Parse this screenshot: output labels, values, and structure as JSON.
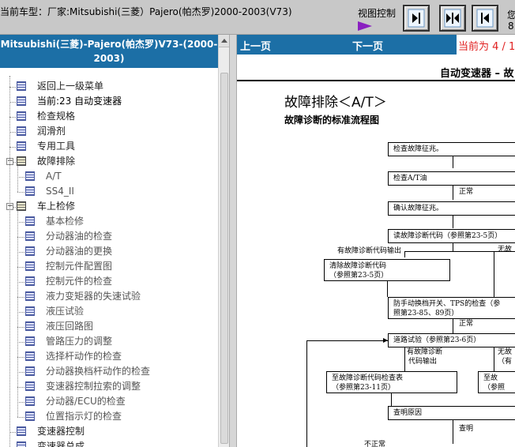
{
  "topbar": {
    "car_model": "当前车型：厂家:Mitsubishi(三菱）Pajero(帕杰罗)2000-2003(V73)",
    "view_control_label": "视图控制",
    "cut_char_1": "您",
    "cut_char_2": "8"
  },
  "left_panel": {
    "title": "Mitsubishi(三菱)-Pajero(帕杰罗)V73-(2000-2003)",
    "tree": [
      {
        "label": "返回上一级菜单",
        "level": 1,
        "type": "page"
      },
      {
        "label": "当前:23 自动变速器",
        "level": 1,
        "type": "page",
        "current": true
      },
      {
        "label": "检查规格",
        "level": 1,
        "type": "page"
      },
      {
        "label": "润滑剂",
        "level": 1,
        "type": "page"
      },
      {
        "label": "专用工具",
        "level": 1,
        "type": "page"
      },
      {
        "label": "故障排除",
        "level": 1,
        "type": "folder",
        "expanded": true
      },
      {
        "label": "A/T",
        "level": 2,
        "type": "page"
      },
      {
        "label": "SS4_II",
        "level": 2,
        "type": "page"
      },
      {
        "label": "车上检修",
        "level": 1,
        "type": "folder",
        "expanded": true
      },
      {
        "label": "基本检修",
        "level": 2,
        "type": "page"
      },
      {
        "label": "分动器油的检查",
        "level": 2,
        "type": "page"
      },
      {
        "label": "分动器油的更换",
        "level": 2,
        "type": "page"
      },
      {
        "label": "控制元件配置图",
        "level": 2,
        "type": "page"
      },
      {
        "label": "控制元件的检查",
        "level": 2,
        "type": "page"
      },
      {
        "label": "液力变矩器的失速试验",
        "level": 2,
        "type": "page"
      },
      {
        "label": "液压试验",
        "level": 2,
        "type": "page"
      },
      {
        "label": "液压回路图",
        "level": 2,
        "type": "page"
      },
      {
        "label": "管路压力的调整",
        "level": 2,
        "type": "page"
      },
      {
        "label": "选择杆动作的检查",
        "level": 2,
        "type": "page"
      },
      {
        "label": "分动器换档杆动作的检查",
        "level": 2,
        "type": "page"
      },
      {
        "label": "变速器控制拉索的调整",
        "level": 2,
        "type": "page"
      },
      {
        "label": "分动器/ECU的检查",
        "level": 2,
        "type": "page"
      },
      {
        "label": "位置指示灯的检查",
        "level": 2,
        "type": "page"
      },
      {
        "label": "变速器控制",
        "level": 1,
        "type": "page"
      },
      {
        "label": "变速器总成",
        "level": 1,
        "type": "page"
      }
    ]
  },
  "right_panel": {
    "prev_label": "上一页",
    "next_label": "下一页",
    "page_status": "当前为 4 / 10"
  },
  "document": {
    "header": "自动变速器 – 故",
    "title": "故障排除＜A/T＞",
    "subtitle": "故障诊断的标准流程图",
    "flow": {
      "b1": "检查故障征兆。",
      "b2": "检查A/T油",
      "l_normal1": "正常",
      "b3": "确认故障征兆。",
      "b4": "读故障诊断代码（参照第23-5页）",
      "l_has_code": "有故障诊断代码输出",
      "l_no_code": "无故",
      "b5_line1": "清除故障诊断代码",
      "b5_line2": "（参照第23-5页）",
      "b6_line1": "防手动换档开关、TPS的检查（参",
      "b6_line2": "照第23-85、89页）",
      "l_normal2": "正常",
      "b7": "道路试验（参照第23-6页）",
      "l_has_code2_line1": "有故障诊断",
      "l_has_code2_line2": "代码输出",
      "l_no_code2_line1": "无故",
      "l_no_code2_line2": "（有",
      "b8_line1": "至故障诊断代码检查表",
      "b8_line2": "（参照第23-11页）",
      "b9_line1": "至故",
      "b9_line2": "（参照",
      "b10": "查明原因",
      "l_found": "查明",
      "l_abnormal": "不正常"
    }
  }
}
